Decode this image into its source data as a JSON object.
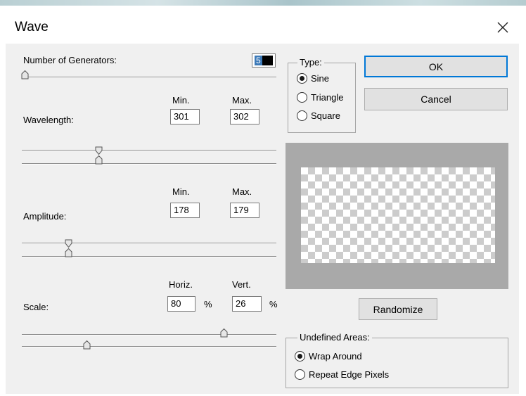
{
  "dialog": {
    "title": "Wave",
    "close_icon": "close-x-icon"
  },
  "generators": {
    "label": "Number of Generators:",
    "value": "5"
  },
  "wavelength": {
    "label": "Wavelength:",
    "min_label": "Min.",
    "max_label": "Max.",
    "min_value": "301",
    "max_value": "302"
  },
  "amplitude": {
    "label": "Amplitude:",
    "min_label": "Min.",
    "max_label": "Max.",
    "min_value": "178",
    "max_value": "179"
  },
  "scale": {
    "label": "Scale:",
    "horiz_label": "Horiz.",
    "vert_label": "Vert.",
    "horiz_value": "80",
    "vert_value": "26",
    "horiz_unit": "%",
    "vert_unit": "%"
  },
  "type": {
    "legend": "Type:",
    "options": [
      "Sine",
      "Triangle",
      "Square"
    ],
    "selected": "Sine"
  },
  "buttons": {
    "ok": "OK",
    "cancel": "Cancel",
    "randomize": "Randomize"
  },
  "undefined_areas": {
    "legend": "Undefined Areas:",
    "options": [
      "Wrap Around",
      "Repeat Edge Pixels"
    ],
    "selected": "Wrap Around"
  },
  "colors": {
    "accent": "#0078d7",
    "preview_frame": "#a9a9a9",
    "dialog_bg": "#f0f0f0"
  }
}
